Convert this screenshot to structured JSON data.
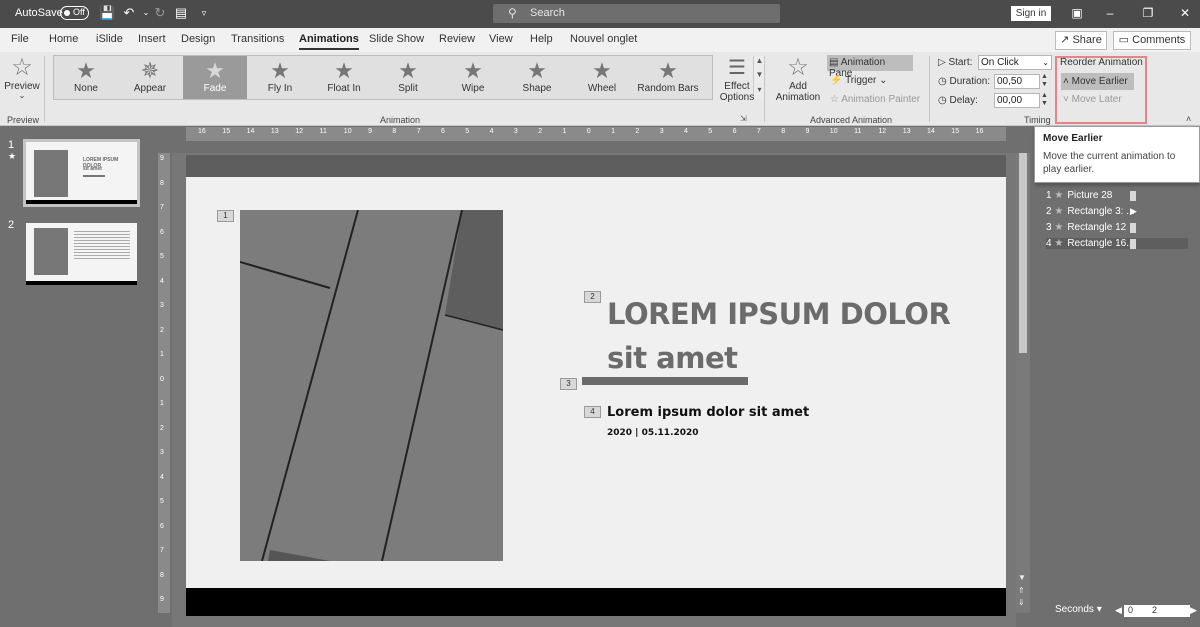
{
  "titlebar": {
    "autosave_label": "AutoSave",
    "autosave_state": "Off",
    "search_placeholder": "Search",
    "sign_in": "Sign in"
  },
  "tabs": [
    "File",
    "Home",
    "iSlide",
    "Insert",
    "Design",
    "Transitions",
    "Animations",
    "Slide Show",
    "Review",
    "View",
    "Help",
    "Nouvel onglet"
  ],
  "active_tab": "Animations",
  "share_label": "Share",
  "comments_label": "Comments",
  "ribbon": {
    "preview_label": "Preview",
    "preview_group": "Preview",
    "animations": [
      "None",
      "Appear",
      "Fade",
      "Fly In",
      "Float In",
      "Split",
      "Wipe",
      "Shape",
      "Wheel",
      "Random Bars"
    ],
    "selected_animation": "Fade",
    "effect_options_1": "Effect",
    "effect_options_2": "Options",
    "animation_group": "Animation",
    "add_animation_1": "Add",
    "add_animation_2": "Animation",
    "animation_pane": "Animation Pane",
    "trigger": "Trigger",
    "animation_painter": "Animation Painter",
    "advanced_group": "Advanced Animation",
    "start_label": "Start:",
    "start_value": "On Click",
    "duration_label": "Duration:",
    "duration_value": "00,50",
    "delay_label": "Delay:",
    "delay_value": "00,00",
    "timing_group": "Timing",
    "reorder_title": "Reorder Animation",
    "move_earlier": "Move Earlier",
    "move_later": "Move Later"
  },
  "slides": [
    "1",
    "2"
  ],
  "slide1_thumb": {
    "title": "LOREM IPSUM DOLOR",
    "sub": "sit amet"
  },
  "slide": {
    "tags": [
      "1",
      "2",
      "3",
      "4"
    ],
    "heading_line1": "LOREM IPSUM DOLOR",
    "heading_line2": "sit amet",
    "subtitle": "Lorem ipsum dolor sit amet",
    "dateline": "2020 | 05.11.2020"
  },
  "hruler_ticks": [
    "16",
    "15",
    "14",
    "13",
    "12",
    "11",
    "10",
    "9",
    "8",
    "7",
    "6",
    "5",
    "4",
    "3",
    "2",
    "1",
    "0",
    "1",
    "2",
    "3",
    "4",
    "5",
    "6",
    "7",
    "8",
    "9",
    "10",
    "11",
    "12",
    "13",
    "14",
    "15",
    "16"
  ],
  "vruler_ticks": [
    "9",
    "8",
    "7",
    "6",
    "5",
    "4",
    "3",
    "2",
    "1",
    "0",
    "1",
    "2",
    "3",
    "4",
    "5",
    "6",
    "7",
    "8",
    "9"
  ],
  "tooltip": {
    "title": "Move Earlier",
    "description": "Move the current animation to play earlier."
  },
  "animation_pane_items": [
    {
      "num": "1",
      "name": "Picture 28"
    },
    {
      "num": "2",
      "name": "Rectangle 3: ..."
    },
    {
      "num": "3",
      "name": "Rectangle 12"
    },
    {
      "num": "4",
      "name": "Rectangle 16..."
    }
  ],
  "seconds_label": "Seconds",
  "timeline_values": [
    "0",
    "2"
  ],
  "colors": {
    "highlight_border": "#e8838a",
    "titlebar": "#4b4b4b",
    "ribbon": "#e8e8e8"
  }
}
